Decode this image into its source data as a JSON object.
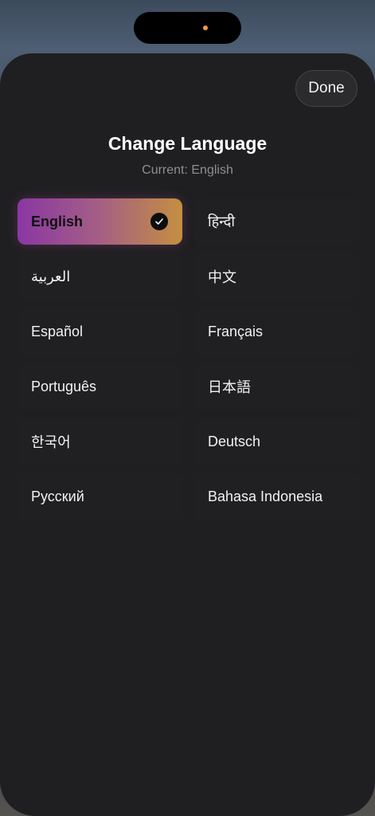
{
  "sheet": {
    "done_label": "Done",
    "title": "Change Language",
    "subtitle": "Current: English"
  },
  "languages": [
    {
      "label": "English",
      "selected": true
    },
    {
      "label": "हिन्दी",
      "selected": false
    },
    {
      "label": "العربية",
      "selected": false
    },
    {
      "label": "中文",
      "selected": false
    },
    {
      "label": "Español",
      "selected": false
    },
    {
      "label": "Français",
      "selected": false
    },
    {
      "label": "Português",
      "selected": false
    },
    {
      "label": "日本語",
      "selected": false
    },
    {
      "label": "한국어",
      "selected": false
    },
    {
      "label": "Deutsch",
      "selected": false
    },
    {
      "label": "Русский",
      "selected": false
    },
    {
      "label": "Bahasa Indonesia",
      "selected": false
    }
  ],
  "icons": {
    "selected": "checkmark-circle-icon"
  },
  "colors": {
    "sheet_background": "#1f1f21",
    "selected_gradient_start": "#8a37a3",
    "selected_gradient_end": "#c48f40",
    "camera_dot": "#f2994a"
  }
}
